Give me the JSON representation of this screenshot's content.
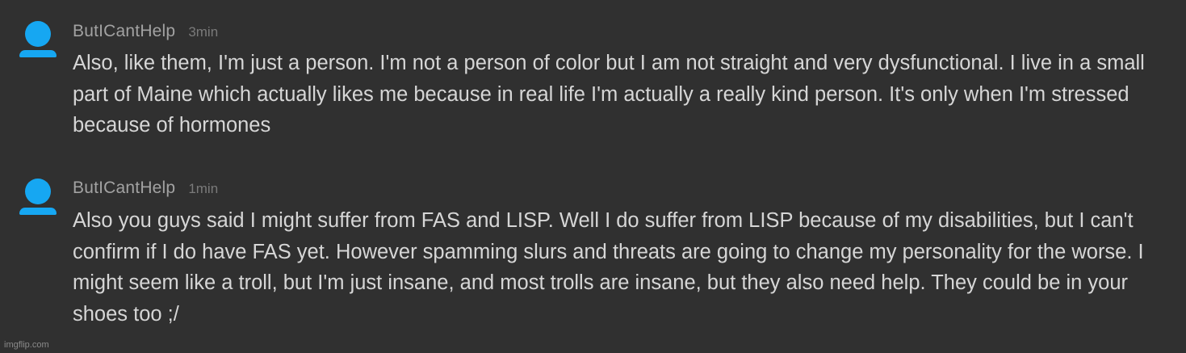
{
  "comments": [
    {
      "username": "ButICantHelp",
      "time": "3min",
      "avatar_icon": "user-avatar-icon",
      "avatar_color": "#16a7f2",
      "text": "Also, like them, I'm just a person. I'm not a person of color but I am not straight and very dysfunctional. I live in a small part of Maine which actually likes me because in real life I'm actually a really kind person. It's only when I'm stressed because of hormones"
    },
    {
      "username": "ButICantHelp",
      "time": "1min",
      "avatar_icon": "user-avatar-icon",
      "avatar_color": "#16a7f2",
      "text": "Also you guys said I might suffer from FAS and LISP. Well I do suffer from LISP because of my disabilities, but I can't confirm if I do have FAS yet. However spamming slurs and threats are going to change my personality for the worse. I might seem like a troll, but I'm just insane, and most trolls are insane, but they also need help. They could be in your shoes too ;/"
    }
  ],
  "watermark": "imgflip.com",
  "colors": {
    "background": "#303030",
    "username": "#a2a2a2",
    "timestamp": "#7a7a7a",
    "comment_text": "#d6d6d6"
  }
}
